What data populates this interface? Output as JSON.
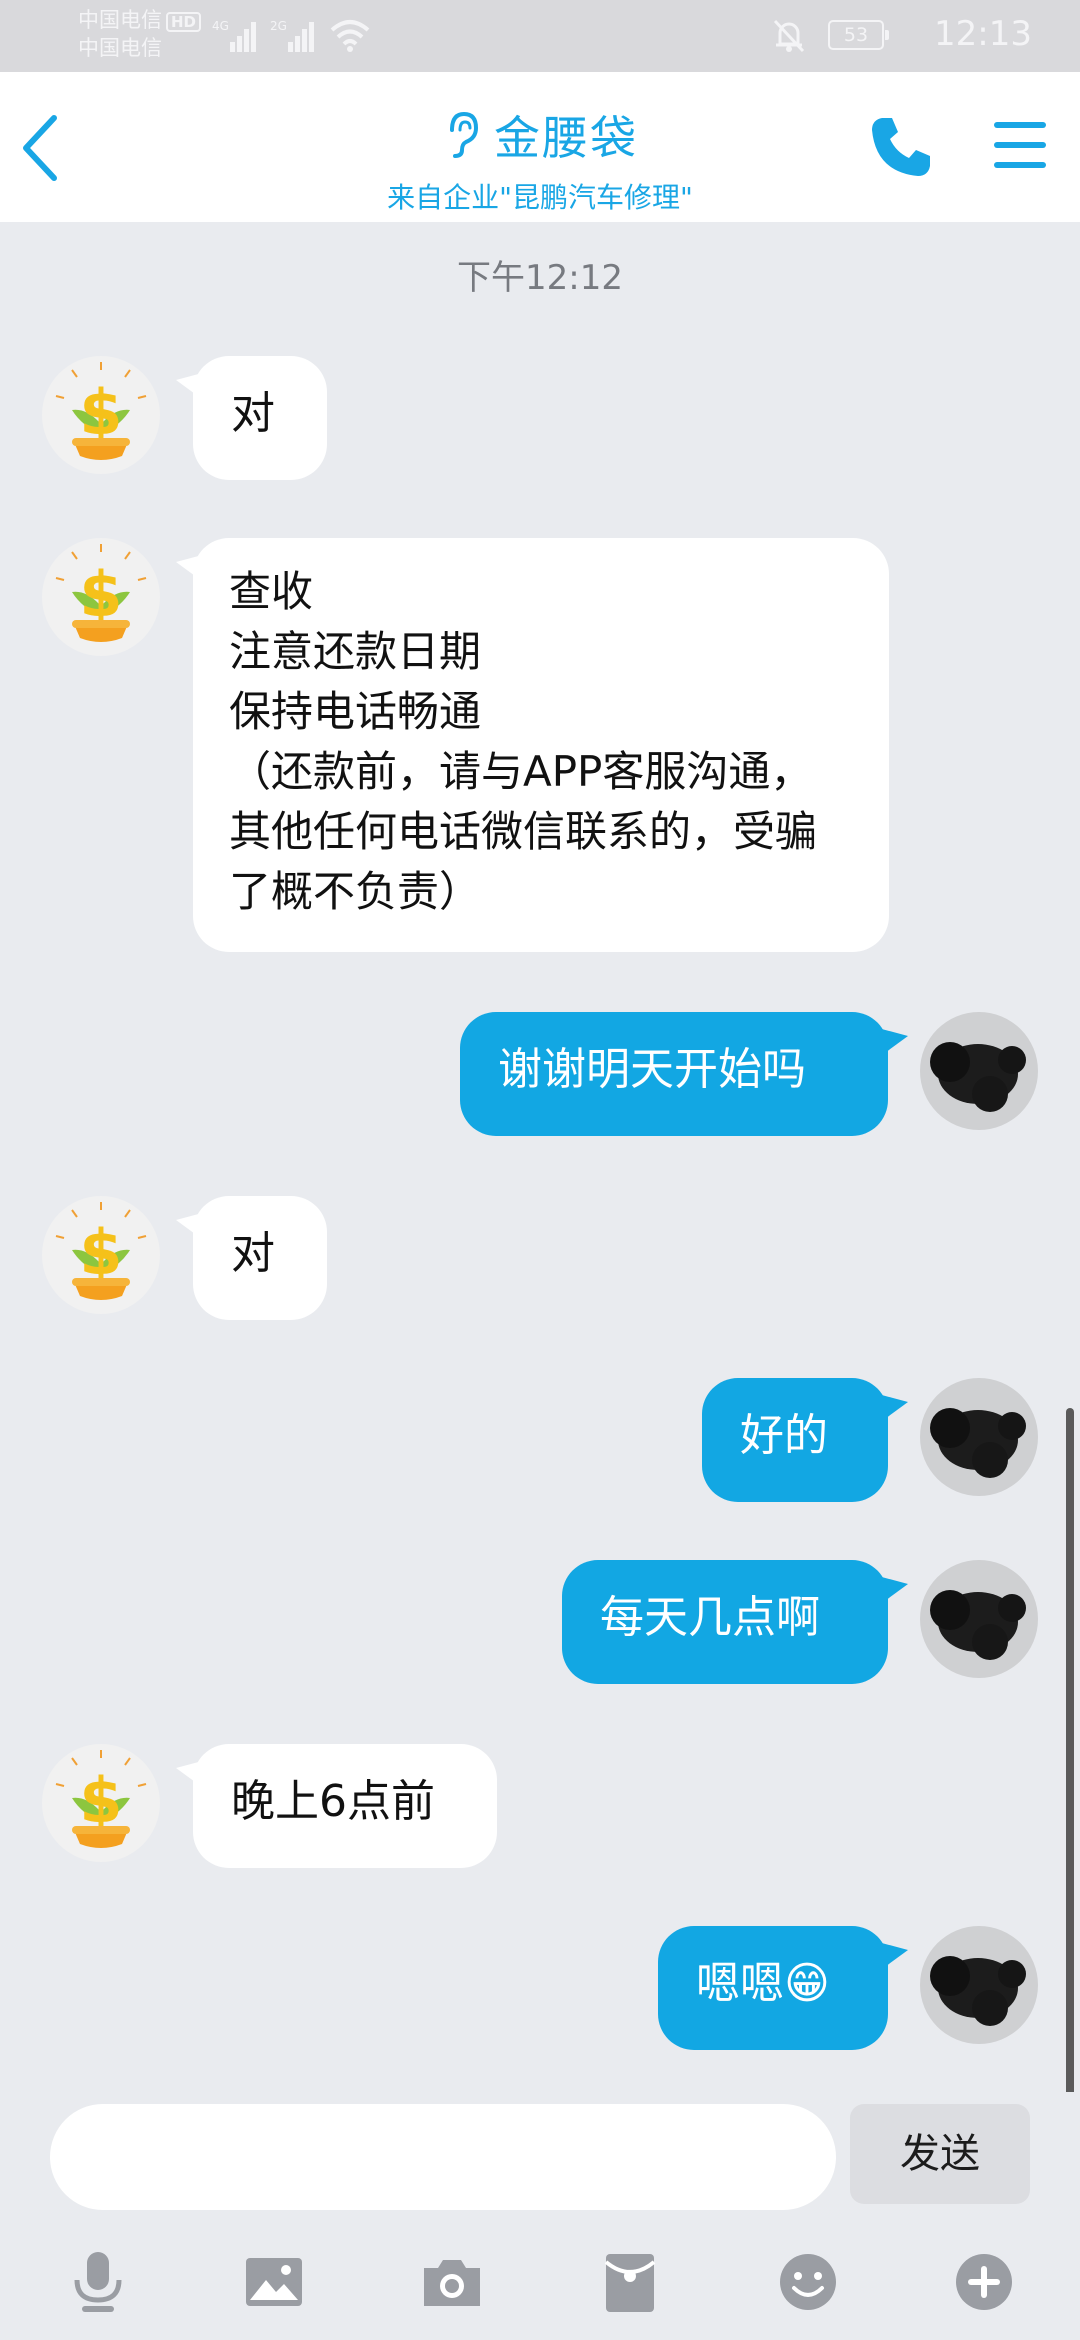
{
  "status_bar": {
    "carrier1": "中国电信",
    "carrier2": "中国电信",
    "hd": "HD",
    "net1": "4G",
    "net2": "2G",
    "battery": "53",
    "time": "12:13"
  },
  "header": {
    "title": "金腰袋",
    "subtitle": "来自企业\"昆鹏汽车修理\"",
    "accent_color": "#19a6e5"
  },
  "chat": {
    "timestamp": "下午12:12",
    "messages": [
      {
        "side": "in",
        "text": "对"
      },
      {
        "side": "in",
        "text": "查收\n注意还款日期\n保持电话畅通\n（还款前，请与APP客服沟通，其他任何电话微信联系的，受骗了概不负责）"
      },
      {
        "side": "out",
        "text": "谢谢明天开始吗"
      },
      {
        "side": "in",
        "text": "对"
      },
      {
        "side": "out",
        "text": "好的"
      },
      {
        "side": "out",
        "text": "每天几点啊"
      },
      {
        "side": "in",
        "text": "晚上6点前"
      },
      {
        "side": "out",
        "text": "嗯嗯😁"
      }
    ]
  },
  "input": {
    "value": "",
    "send_label": "发送"
  },
  "toolbar": {
    "icons": [
      "mic-icon",
      "image-icon",
      "camera-icon",
      "red-packet-icon",
      "emoji-icon",
      "plus-icon"
    ]
  },
  "colors": {
    "outgoing_bubble": "#12a7e3",
    "incoming_bubble": "#ffffff",
    "background": "#e9ebef"
  }
}
